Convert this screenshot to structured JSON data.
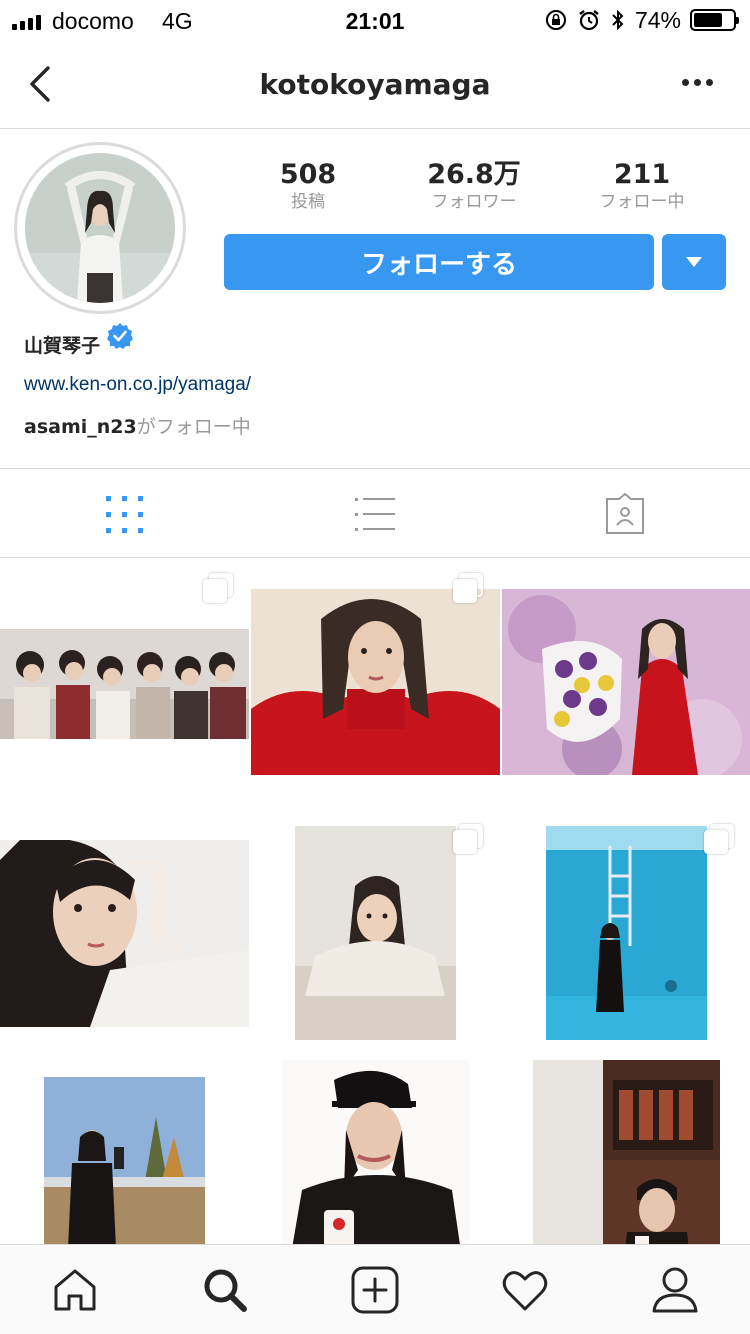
{
  "status_bar": {
    "carrier": "docomo",
    "network": "4G",
    "time": "21:01",
    "battery_percent": "74%",
    "battery_level": 0.74
  },
  "header": {
    "username": "kotokoyamaga",
    "back_icon": "chevron-left-icon",
    "more_icon": "ellipsis-icon"
  },
  "profile": {
    "stats": [
      {
        "value": "508",
        "label": "投稿"
      },
      {
        "value": "26.8万",
        "label": "フォロワー"
      },
      {
        "value": "211",
        "label": "フォロー中"
      }
    ],
    "follow_button": "フォローする",
    "display_name": "山賀琴子",
    "website": "www.ken-on.co.jp/yamaga/",
    "followed_by_user": "asami_n23",
    "followed_by_suffix": "がフォロー中"
  },
  "tabs": [
    {
      "icon": "grid-icon",
      "active": true
    },
    {
      "icon": "list-icon",
      "active": false
    },
    {
      "icon": "tagged-icon",
      "active": false
    }
  ],
  "bottom_nav": [
    {
      "icon": "home-icon"
    },
    {
      "icon": "search-icon"
    },
    {
      "icon": "add-post-icon"
    },
    {
      "icon": "heart-icon"
    },
    {
      "icon": "profile-icon"
    }
  ],
  "colors": {
    "accent": "#3897f0",
    "link": "#003569",
    "muted": "#999999",
    "border": "#dbdbdb"
  }
}
